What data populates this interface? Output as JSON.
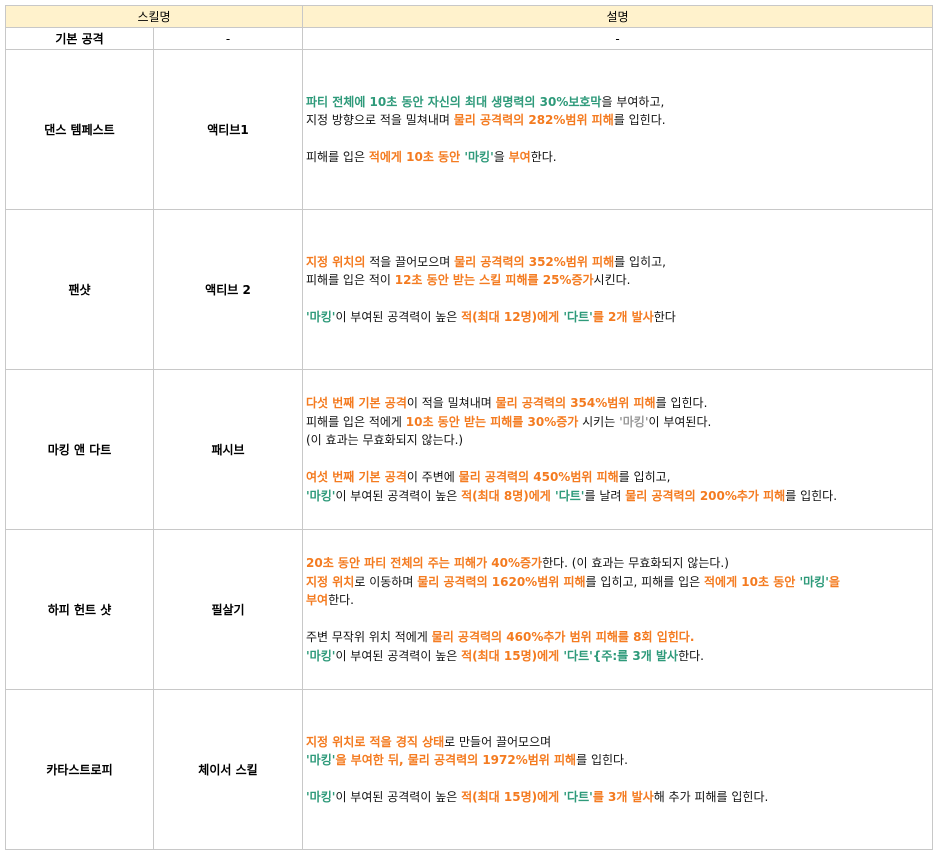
{
  "header": {
    "skill_name": "스킬명",
    "description": "설명"
  },
  "basic_attack": {
    "name": "기본 공격",
    "type": "-",
    "description": "-"
  },
  "colors": {
    "orange": "#f47b20",
    "green": "#2e9a7a",
    "header_bg": "#fff2cc"
  },
  "skills": [
    {
      "name": "댄스 템페스트",
      "type": "액티브1",
      "lines": [
        [
          {
            "t": "파티 전체에 10초 동안 자신의 최대 생명력의 30%보호막",
            "c": "g"
          },
          {
            "t": "을 부여하고,",
            "c": "k"
          }
        ],
        [
          {
            "t": "지정 방향으로 적을 밀쳐내며 ",
            "c": "k"
          },
          {
            "t": "물리 공격력의 282%범위 피해",
            "c": "o"
          },
          {
            "t": "를 입힌다.",
            "c": "k"
          }
        ],
        [],
        [
          {
            "t": "피해를 입은 ",
            "c": "k"
          },
          {
            "t": "적에게 10초 동안 ",
            "c": "o"
          },
          {
            "t": "'마킹'",
            "c": "g"
          },
          {
            "t": "을 ",
            "c": "k"
          },
          {
            "t": "부여",
            "c": "o"
          },
          {
            "t": "한다.",
            "c": "k"
          }
        ]
      ]
    },
    {
      "name": "팬샷",
      "type": "액티브 2",
      "lines": [
        [
          {
            "t": "지정 위치의",
            "c": "o"
          },
          {
            "t": " 적을 끌어모으며 ",
            "c": "k"
          },
          {
            "t": "물리 공격력의 352%범위 피해",
            "c": "o"
          },
          {
            "t": "를 입히고,",
            "c": "k"
          }
        ],
        [
          {
            "t": "피해를 입은 적이 ",
            "c": "k"
          },
          {
            "t": "12초 동안 받는 스킬 피해를 25%증가",
            "c": "o"
          },
          {
            "t": "시킨다.",
            "c": "k"
          }
        ],
        [],
        [
          {
            "t": "'마킹'",
            "c": "g"
          },
          {
            "t": "이 부여된 공격력이 높은 ",
            "c": "k"
          },
          {
            "t": "적(최대 12명)에게 ",
            "c": "o"
          },
          {
            "t": "'다트'",
            "c": "g"
          },
          {
            "t": "를 2개 발사",
            "c": "o"
          },
          {
            "t": "한다",
            "c": "k"
          }
        ]
      ]
    },
    {
      "name": "마킹 앤 다트",
      "type": "패시브",
      "lines": [
        [
          {
            "t": "다섯 번째 기본 공격",
            "c": "o"
          },
          {
            "t": "이 적을 밀쳐내며 ",
            "c": "k"
          },
          {
            "t": "물리 공격력의 354%범위 피해",
            "c": "o"
          },
          {
            "t": "를 입힌다.",
            "c": "k"
          }
        ],
        [
          {
            "t": "피해를 입은 적에게 ",
            "c": "k"
          },
          {
            "t": "10초 동안 받는 피해를 30%증가",
            "c": "o"
          },
          {
            "t": " 시키는 ",
            "c": "k"
          },
          {
            "t": "'마킹'",
            "c": "s"
          },
          {
            "t": "이 부여된다.",
            "c": "k"
          }
        ],
        [
          {
            "t": "(이 효과는 무효화되지 않는다.)",
            "c": "k"
          }
        ],
        [],
        [
          {
            "t": "여섯 번째 기본 공격",
            "c": "o"
          },
          {
            "t": "이 주변에 ",
            "c": "k"
          },
          {
            "t": "물리 공격력의 450%범위 피해",
            "c": "o"
          },
          {
            "t": "를 입히고,",
            "c": "k"
          }
        ],
        [
          {
            "t": "'마킹'",
            "c": "g"
          },
          {
            "t": "이 부여된 공격력이 높은 ",
            "c": "k"
          },
          {
            "t": "적(최대 8명)에게 ",
            "c": "o"
          },
          {
            "t": "'다트'",
            "c": "g"
          },
          {
            "t": "를 날려 ",
            "c": "k"
          },
          {
            "t": "물리 공격력의 200%추가 피해",
            "c": "o"
          },
          {
            "t": "를 입힌다.",
            "c": "k"
          }
        ]
      ]
    },
    {
      "name": "하피 헌트 샷",
      "type": "필살기",
      "lines": [
        [
          {
            "t": "20초 동안 파티 전체의 주는 피해가 40%증가",
            "c": "o"
          },
          {
            "t": "한다. (이 효과는 무효화되지 않는다.)",
            "c": "k"
          }
        ],
        [
          {
            "t": "지정 위치",
            "c": "o"
          },
          {
            "t": "로 이동하며 ",
            "c": "k"
          },
          {
            "t": "물리 공격력의 1620%범위 피해",
            "c": "o"
          },
          {
            "t": "를 입히고, 피해를 입은 ",
            "c": "k"
          },
          {
            "t": "적에게 10초 동안 ",
            "c": "o"
          },
          {
            "t": "'마킹'",
            "c": "g"
          },
          {
            "t": "을",
            "c": "o"
          }
        ],
        [
          {
            "t": "부여",
            "c": "o"
          },
          {
            "t": "한다.",
            "c": "k"
          }
        ],
        [],
        [
          {
            "t": "주변 무작위 위치 적에게 ",
            "c": "k"
          },
          {
            "t": "물리 공격력의 460%추가 범위 피해를 8회 입힌다.",
            "c": "o"
          }
        ],
        [
          {
            "t": "'마킹'",
            "c": "g"
          },
          {
            "t": "이 부여된 공격력이 높은 ",
            "c": "k"
          },
          {
            "t": "적(최대 15명)에게 ",
            "c": "o"
          },
          {
            "t": "'다트'{주:를 3개 발사",
            "c": "g"
          },
          {
            "t": "한다.",
            "c": "k"
          }
        ]
      ]
    },
    {
      "name": "카타스트로피",
      "type": "체이서 스킬",
      "lines": [
        [
          {
            "t": "지정 위치로 적을 경직 상태",
            "c": "o"
          },
          {
            "t": "로 만들어 끌어모으며",
            "c": "k"
          }
        ],
        [
          {
            "t": "'마킹'",
            "c": "g"
          },
          {
            "t": "을 부여한 뒤, 물리 공격력의 1972%범위 피해",
            "c": "o"
          },
          {
            "t": "를 입힌다.",
            "c": "k"
          }
        ],
        [],
        [
          {
            "t": "'마킹'",
            "c": "g"
          },
          {
            "t": "이 부여된 공격력이 높은 ",
            "c": "k"
          },
          {
            "t": "적(최대 15명)에게 ",
            "c": "o"
          },
          {
            "t": "'다트'",
            "c": "g"
          },
          {
            "t": "를 3개 발사",
            "c": "o"
          },
          {
            "t": "해 추가 피해를 입힌다.",
            "c": "k"
          }
        ]
      ]
    }
  ]
}
